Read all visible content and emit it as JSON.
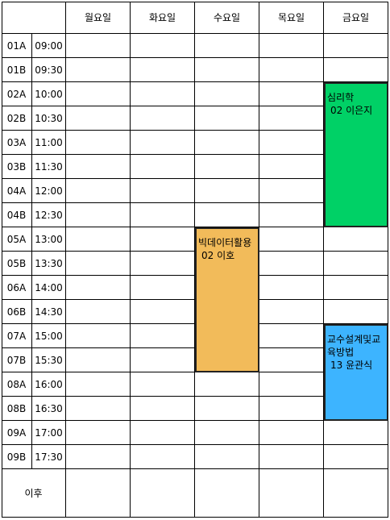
{
  "days": [
    "월요일",
    "화요일",
    "수요일",
    "목요일",
    "금요일"
  ],
  "rows": [
    {
      "code": "01A",
      "time": "09:00"
    },
    {
      "code": "01B",
      "time": "09:30"
    },
    {
      "code": "02A",
      "time": "10:00"
    },
    {
      "code": "02B",
      "time": "10:30"
    },
    {
      "code": "03A",
      "time": "11:00"
    },
    {
      "code": "03B",
      "time": "11:30"
    },
    {
      "code": "04A",
      "time": "12:00"
    },
    {
      "code": "04B",
      "time": "12:30"
    },
    {
      "code": "05A",
      "time": "13:00"
    },
    {
      "code": "05B",
      "time": "13:30"
    },
    {
      "code": "06A",
      "time": "14:00"
    },
    {
      "code": "06B",
      "time": "14:30"
    },
    {
      "code": "07A",
      "time": "15:00"
    },
    {
      "code": "07B",
      "time": "15:30"
    },
    {
      "code": "08A",
      "time": "16:00"
    },
    {
      "code": "08B",
      "time": "16:30"
    },
    {
      "code": "09A",
      "time": "17:00"
    },
    {
      "code": "09B",
      "time": "17:30"
    }
  ],
  "after_label": "이후",
  "courses": [
    {
      "name": "심리학",
      "info": "02 이은지",
      "day": 4,
      "start": 2,
      "span": 6,
      "color": "#00d166"
    },
    {
      "name": "빅데이터활용",
      "info": "02 이호",
      "day": 2,
      "start": 8,
      "span": 6,
      "color": "#f2bb5a"
    },
    {
      "name": "교수설계및교육방법",
      "info": "13 윤관식",
      "day": 4,
      "start": 12,
      "span": 4,
      "color": "#3db4ff"
    }
  ]
}
